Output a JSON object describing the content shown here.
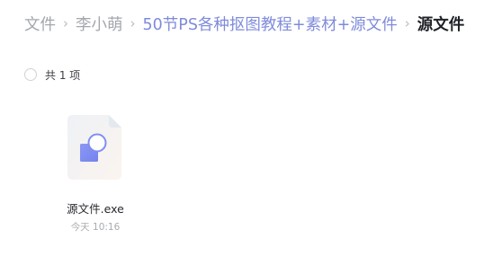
{
  "breadcrumb": {
    "items": [
      {
        "label": "文件"
      },
      {
        "label": "李小萌"
      },
      {
        "label": "50节PS各种抠图教程+素材+源文件"
      },
      {
        "label": "源文件"
      }
    ],
    "separator": "›"
  },
  "selection": {
    "count_label": "共 1 项"
  },
  "files": [
    {
      "name": "源文件.exe",
      "time": "今天 10:16",
      "icon": "executable-file-icon"
    }
  ],
  "colors": {
    "link": "#7f8bdb",
    "muted": "#a3a7ad",
    "current": "#1e2126",
    "icon_accent": "#7f8ef2"
  }
}
